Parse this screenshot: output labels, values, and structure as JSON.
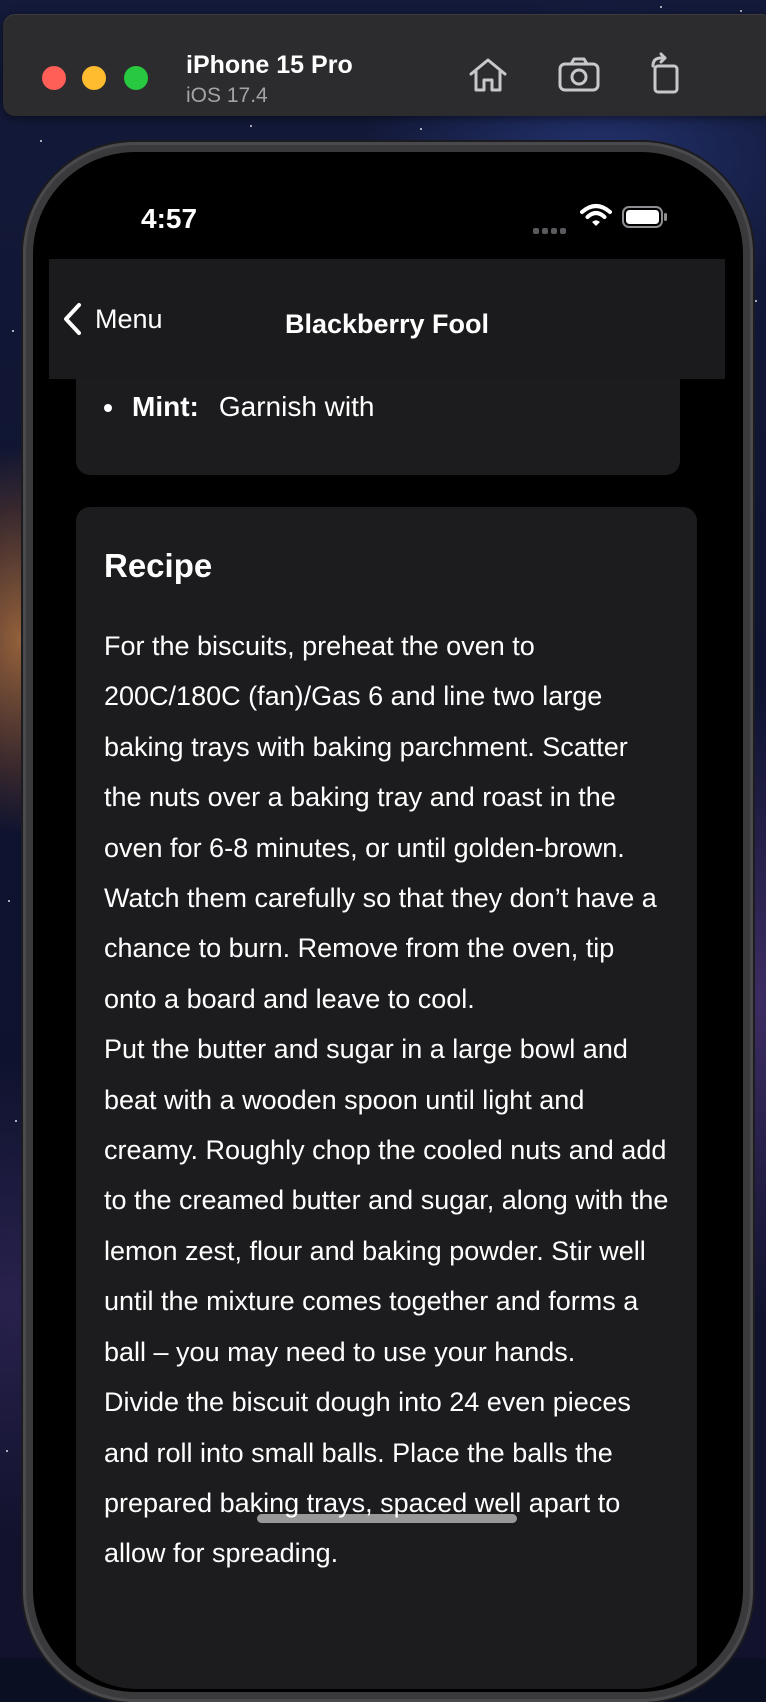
{
  "simulator": {
    "device_name": "iPhone 15 Pro",
    "os_version": "iOS 17.4",
    "toolbar": {
      "home_icon": "home-icon",
      "screenshot_icon": "camera-icon",
      "rotate_icon": "rotate-icon"
    }
  },
  "status_bar": {
    "time": "4:57"
  },
  "nav": {
    "back_label": "Menu",
    "title": "Blackberry Fool"
  },
  "ingredients": {
    "visible_item": {
      "name": "Mint:",
      "note": "Garnish with"
    }
  },
  "recipe": {
    "title": "Recipe",
    "paragraphs": [
      "For the biscuits, preheat the oven to 200C/180C (fan)/Gas 6 and line two large baking trays with baking parchment. Scatter the nuts over a baking tray and roast in the oven for 6-8 minutes, or until golden-brown. Watch them carefully so that they don’t have a chance to burn. Remove from the oven, tip onto a board and leave to cool.",
      "Put the butter and sugar in a large bowl and beat with a wooden spoon until light and creamy. Roughly chop the cooled nuts and add to the creamed butter and sugar, along with the lemon zest, flour and baking powder. Stir well until the mixture comes together and forms a ball – you may need to use your hands.",
      "Divide the biscuit dough into 24 even pieces and roll into small balls. Place the balls the prepared baking trays, spaced well apart to allow for spreading."
    ]
  },
  "colors": {
    "background": "#000000",
    "card": "#1c1c1e",
    "nav_bar": "#1b1b1d",
    "text": "#ffffff",
    "close": "#ff5f57",
    "minimize": "#febc2e",
    "zoom": "#28c840"
  }
}
